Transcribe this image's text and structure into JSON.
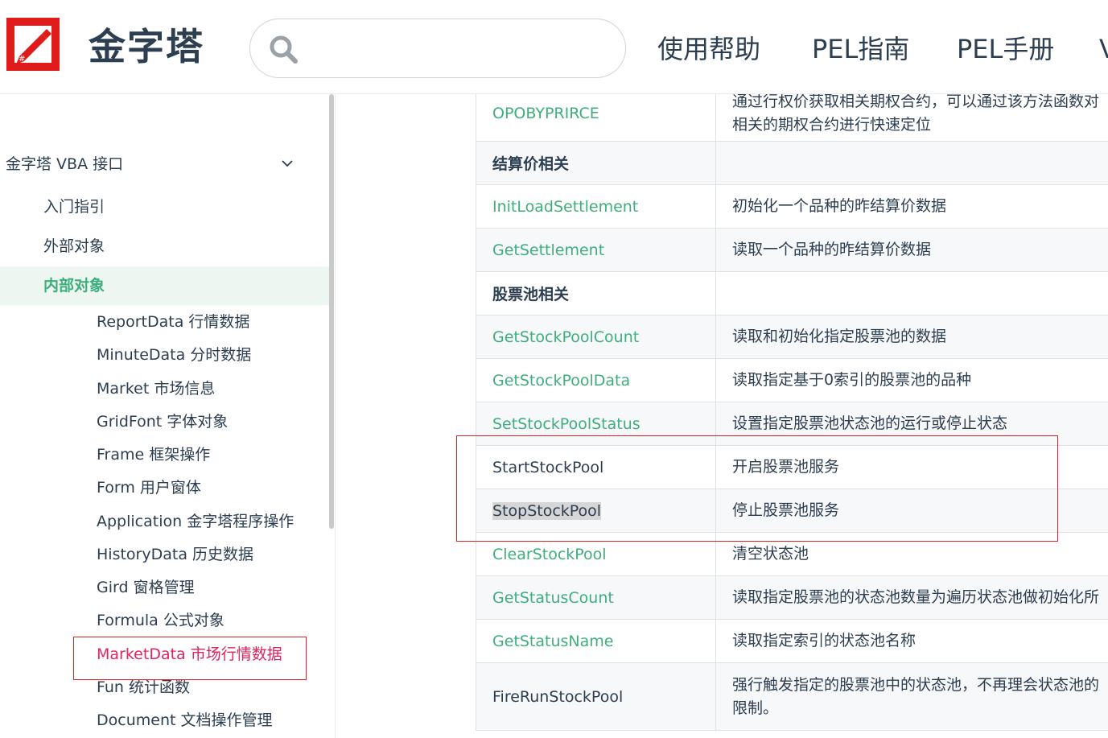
{
  "header": {
    "site_name": "金字塔",
    "search": {
      "value": "",
      "placeholder": ""
    },
    "nav": [
      {
        "label": "使用帮助"
      },
      {
        "label": "PEL指南"
      },
      {
        "label": "PEL手册"
      },
      {
        "label": "V"
      }
    ]
  },
  "sidebar": {
    "group_title": "金字塔 VBA 接口",
    "items": [
      {
        "label": "入门指引"
      },
      {
        "label": "外部对象"
      },
      {
        "label": "内部对象"
      }
    ],
    "subitems": [
      {
        "label": "ReportData 行情数据"
      },
      {
        "label": "MinuteData 分时数据"
      },
      {
        "label": "Market 市场信息"
      },
      {
        "label": "GridFont 字体对象"
      },
      {
        "label": "Frame 框架操作"
      },
      {
        "label": "Form 用户窗体"
      },
      {
        "label": "Application 金字塔程序操作"
      },
      {
        "label": "HistoryData 历史数据"
      },
      {
        "label": "Gird 窗格管理"
      },
      {
        "label": "Formula 公式对象"
      },
      {
        "label": "MarketData 市场行情数据"
      },
      {
        "label": "Fun 统计函数"
      },
      {
        "label": "Document 文档操作管理"
      }
    ]
  },
  "table": {
    "rows": [
      {
        "name": "OPOBYPRIRCE",
        "desc": "通过行权价获取相关期权合约，可以通过该方法函数对相关的期权合约进行快速定位"
      },
      {
        "name": "结算价相关",
        "desc": ""
      },
      {
        "name": "InitLoadSettlement",
        "desc": "初始化一个品种的昨结算价数据"
      },
      {
        "name": "GetSettlement",
        "desc": "读取一个品种的昨结算价数据"
      },
      {
        "name": "股票池相关",
        "desc": ""
      },
      {
        "name": "GetStockPoolCount",
        "desc": "读取和初始化指定股票池的数据"
      },
      {
        "name": "GetStockPoolData",
        "desc": "读取指定基于0索引的股票池的品种"
      },
      {
        "name": "SetStockPoolStatus",
        "desc": "设置指定股票池状态池的运行或停止状态"
      },
      {
        "name": "StartStockPool",
        "desc": "开启股票池服务"
      },
      {
        "name": "StopStockPool",
        "desc": "停止股票池服务"
      },
      {
        "name": "ClearStockPool",
        "desc": "清空状态池"
      },
      {
        "name": "GetStatusCount",
        "desc": "读取指定股票池的状态池数量为遍历状态池做初始化所"
      },
      {
        "name": "GetStatusName",
        "desc": "读取指定索引的状态池名称"
      },
      {
        "name": "FireRunStockPool",
        "desc": "强行触发指定的股票池中的状态池，不再理会状态池的限制。"
      }
    ]
  }
}
